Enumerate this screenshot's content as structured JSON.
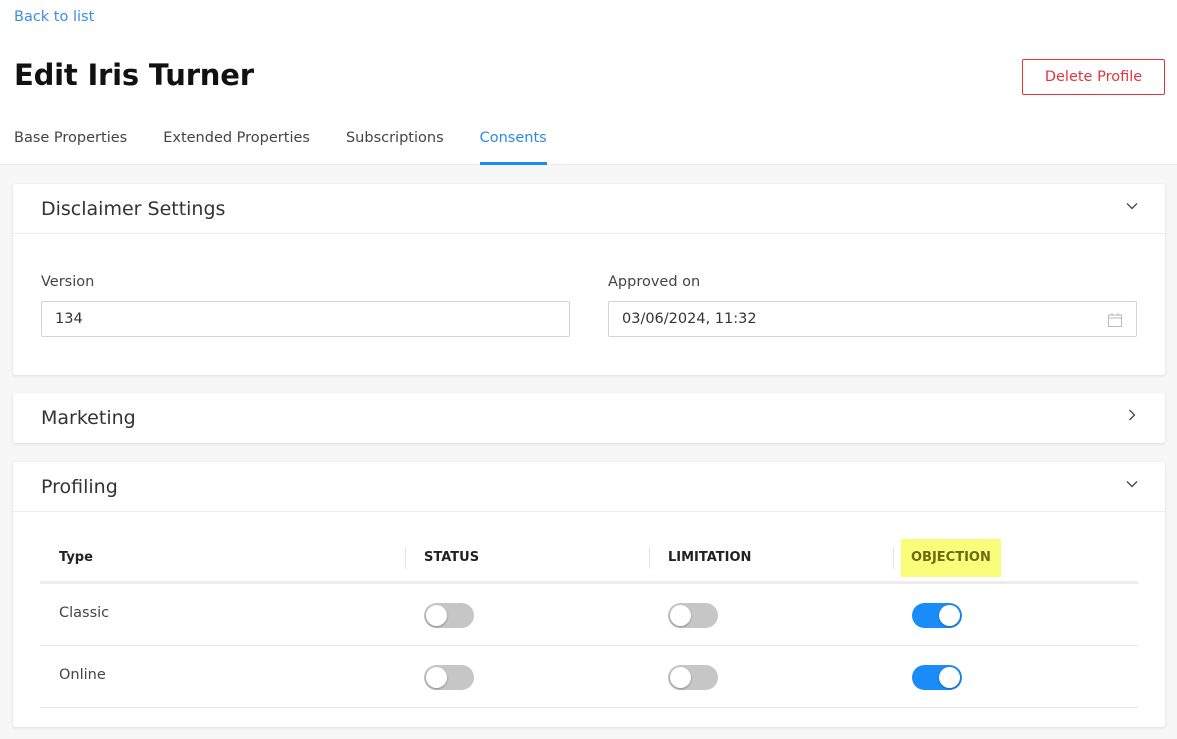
{
  "nav": {
    "back_link": "Back to list"
  },
  "header": {
    "title": "Edit Iris Turner",
    "delete_button": "Delete Profile"
  },
  "tabs": [
    {
      "label": "Base Properties",
      "active": false
    },
    {
      "label": "Extended Properties",
      "active": false
    },
    {
      "label": "Subscriptions",
      "active": false
    },
    {
      "label": "Consents",
      "active": true
    }
  ],
  "colors": {
    "accent": "#1e8af0",
    "danger": "#e0343d",
    "toggle_on": "#1a8cf7",
    "toggle_off": "#c6c6c6",
    "highlight": "#fafd7a"
  },
  "disclaimer": {
    "title": "Disclaimer Settings",
    "expanded": true,
    "version_label": "Version",
    "version_value": "134",
    "approved_label": "Approved on",
    "approved_value": "03/06/2024, 11:32",
    "approved_icon": "calendar-icon"
  },
  "marketing": {
    "title": "Marketing",
    "expanded": false
  },
  "profiling": {
    "title": "Profiling",
    "expanded": true,
    "columns": [
      "Type",
      "STATUS",
      "LIMITATION",
      "OBJECTION"
    ],
    "rows": [
      {
        "type": "Classic",
        "status": false,
        "limitation": false,
        "objection": true
      },
      {
        "type": "Online",
        "status": false,
        "limitation": false,
        "objection": true
      }
    ]
  }
}
